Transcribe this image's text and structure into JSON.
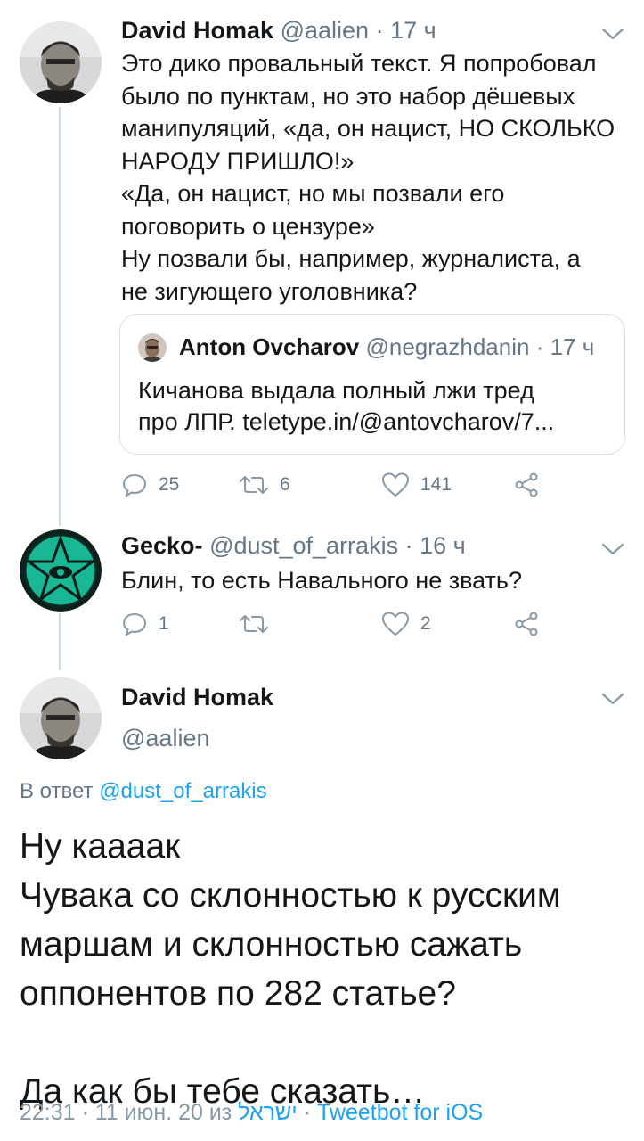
{
  "tweet1": {
    "name": "David Homak",
    "handle": "@aalien",
    "dot": "·",
    "time": "17 ч",
    "lines": [
      "Это дико провальный текст. Я попробовал",
      "было  по пунктам, но это набор дёшевых",
      "манипуляций, «да, он нацист, НО СКОЛЬКО",
      "НАРОДУ ПРИШЛО!»",
      "«Да, он нацист, но мы позвали его",
      "поговорить о цензуре»",
      "Ну позвали бы, например, журналиста, а",
      "не зигующего уголовника?"
    ],
    "quote": {
      "name": "Anton Ovcharov",
      "handle": "@negrazhdanin",
      "dot": "·",
      "time": "17 ч",
      "lines": [
        "Кичанова выдала полный лжи тред",
        "про ЛПР. teletype.in/@antovcharov/7..."
      ]
    },
    "actions": {
      "replies": "25",
      "retweets": "6",
      "likes": "141"
    }
  },
  "tweet2": {
    "name": "Gecko-",
    "handle": "@dust_of_arrakis",
    "dot": "·",
    "time": "16 ч",
    "lines": [
      "Блин, то есть Навального не звать?"
    ],
    "actions": {
      "replies": "1",
      "retweets": "",
      "likes": "2"
    }
  },
  "tweet3": {
    "name": "David Homak",
    "handle": "@aalien",
    "reply_prefix": "В ответ",
    "reply_handle": "@dust_of_arrakis",
    "lines": [
      "Ну кааaак",
      "Чувака со склонностью к русским",
      "маршам и склонностью сажать",
      "оппонентов по 282 статье?",
      "",
      "Да как бы тебе сказать…"
    ],
    "footer_time": "22:31 · 11 июн. 20 из",
    "footer_place": "ישראל",
    "footer_sep": "·",
    "footer_client": "Tweetbot for iOS"
  },
  "icons": {
    "reply": "reply-icon",
    "retweet": "retweet-icon",
    "like": "heart-icon",
    "share": "share-icon",
    "menu": "chevron-down-icon"
  },
  "colors": {
    "text": "#14171a",
    "secondary": "#657786",
    "link": "#1da1f2",
    "thread_line": "#cfd9de"
  }
}
